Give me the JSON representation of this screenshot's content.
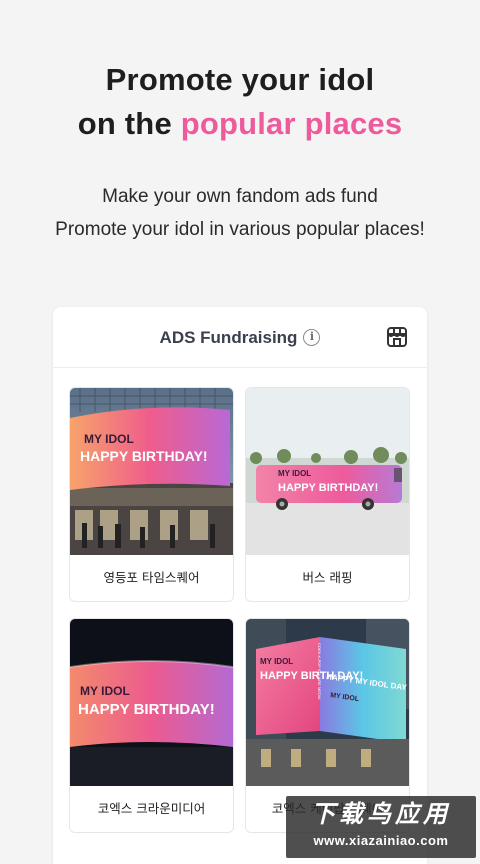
{
  "hero": {
    "title_line1": "Promote your idol",
    "title_line2_prefix": "on the ",
    "title_line2_accent": "popular places",
    "subtitle_line1": "Make your own fandom ads fund",
    "subtitle_line2": "Promote your idol in various popular places!"
  },
  "card": {
    "title": "ADS Fundraising",
    "info_icon": "i",
    "store_icon": "store-icon"
  },
  "places": [
    {
      "label": "영등포 타임스퀘어",
      "ad_line1": "MY IDOL",
      "ad_line2": "HAPPY BIRTHDAY!"
    },
    {
      "label": "버스 래핑",
      "ad_line1": "MY IDOL",
      "ad_line2": "HAPPY BIRTHDAY!"
    },
    {
      "label": "코엑스 크라운미디어",
      "ad_line1": "MY IDOL",
      "ad_line2": "HAPPY BIRTHDAY!"
    },
    {
      "label": "코엑스 케이팝 스퀘어",
      "ad_line1": "MY IDOL",
      "ad_line2": "HAPPY BIRTH DAY!",
      "ad_side": "HAPPY MY IDOL DAY",
      "ad_side2": "MY IDOL",
      "ad_vert": "COEX K-POP SQUARE MEDIA"
    }
  ],
  "watermark": {
    "line1": "下载鸟应用",
    "line2": "www.xiazainiao.com"
  },
  "colors": {
    "accent": "#ee5b9c",
    "background": "#f4f4f4"
  }
}
